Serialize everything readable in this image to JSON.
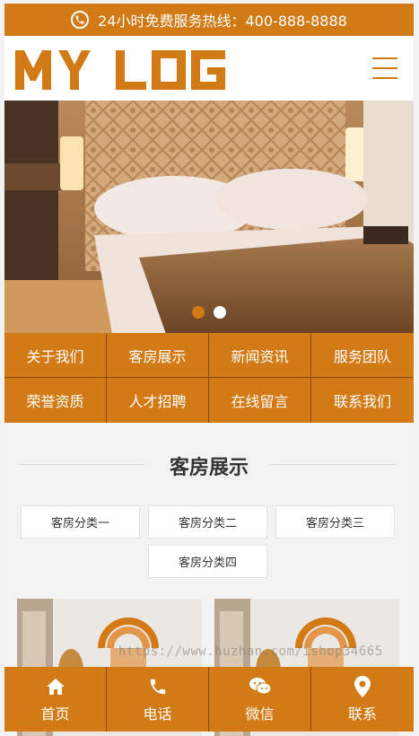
{
  "hotline": {
    "text": "24小时免费服务热线：400-888-8888"
  },
  "logo": {
    "text": "MY LOGO"
  },
  "nav": [
    {
      "label": "关于我们"
    },
    {
      "label": "客房展示"
    },
    {
      "label": "新闻资讯"
    },
    {
      "label": "服务团队"
    },
    {
      "label": "荣誉资质"
    },
    {
      "label": "人才招聘"
    },
    {
      "label": "在线留言"
    },
    {
      "label": "联系我们"
    }
  ],
  "section": {
    "title": "客房展示",
    "categories": [
      "客房分类一",
      "客房分类二",
      "客房分类三",
      "客房分类四"
    ]
  },
  "watermark": "https://www.huzhan.com/ishop34665",
  "bottom": [
    {
      "label": "首页",
      "icon": "home-icon"
    },
    {
      "label": "电话",
      "icon": "phone-icon"
    },
    {
      "label": "微信",
      "icon": "wechat-icon"
    },
    {
      "label": "联系",
      "icon": "location-icon"
    }
  ],
  "colors": {
    "accent": "#d17a16",
    "divider": "#8a4a08"
  }
}
